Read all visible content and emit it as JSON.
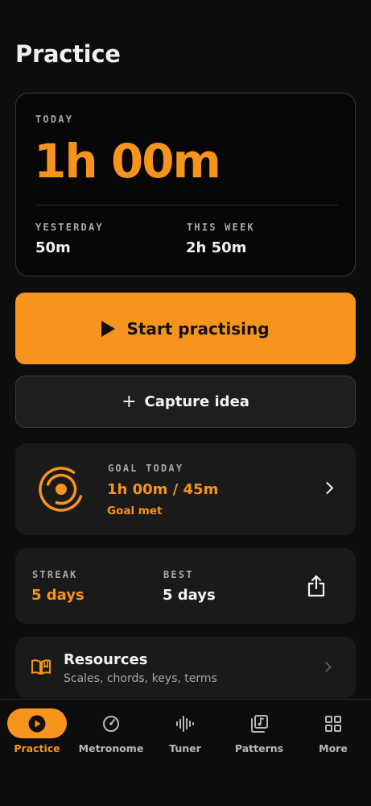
{
  "header": {
    "title": "Practice"
  },
  "today_card": {
    "today_label": "TODAY",
    "today_value": "1h 00m",
    "yesterday_label": "YESTERDAY",
    "yesterday_value": "50m",
    "week_label": "THIS WEEK",
    "week_value": "2h 50m"
  },
  "actions": {
    "start_label": "Start practising",
    "capture_label": "Capture idea"
  },
  "goal": {
    "label": "GOAL TODAY",
    "value": "1h 00m / 45m",
    "status": "Goal met"
  },
  "streak": {
    "streak_label": "STREAK",
    "streak_value": "5 days",
    "best_label": "BEST",
    "best_value": "5 days"
  },
  "resources": {
    "title": "Resources",
    "subtitle": "Scales, chords, keys, terms"
  },
  "tabbar": {
    "items": [
      {
        "label": "Practice",
        "icon": "play-circle-icon",
        "active": true
      },
      {
        "label": "Metronome",
        "icon": "metronome-icon",
        "active": false
      },
      {
        "label": "Tuner",
        "icon": "waveform-icon",
        "active": false
      },
      {
        "label": "Patterns",
        "icon": "music-note-library-icon",
        "active": false
      },
      {
        "label": "More",
        "icon": "grid-icon",
        "active": false
      }
    ]
  },
  "colors": {
    "accent": "#f7941d",
    "background": "#0d0d0d",
    "card": "#1a1a1a"
  }
}
